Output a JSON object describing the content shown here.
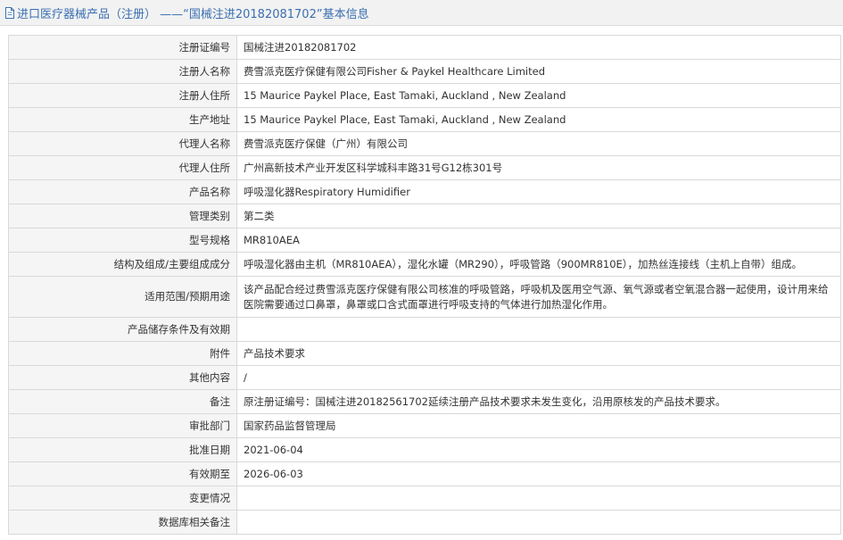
{
  "header": {
    "title": "进口医疗器械产品（注册） ——“国械注进20182081702”基本信息",
    "icon": "document-icon"
  },
  "rows": [
    {
      "label": "注册证编号",
      "value": "国械注进20182081702"
    },
    {
      "label": "注册人名称",
      "value": "费雪派克医疗保健有限公司Fisher & Paykel Healthcare Limited"
    },
    {
      "label": "注册人住所",
      "value": "15 Maurice Paykel Place, East Tamaki, Auckland , New Zealand"
    },
    {
      "label": "生产地址",
      "value": "15 Maurice Paykel Place, East Tamaki, Auckland , New Zealand"
    },
    {
      "label": "代理人名称",
      "value": "费雪派克医疗保健（广州）有限公司"
    },
    {
      "label": "代理人住所",
      "value": "广州高新技术产业开发区科学城科丰路31号G12栋301号"
    },
    {
      "label": "产品名称",
      "value": "呼吸湿化器Respiratory Humidifier"
    },
    {
      "label": "管理类别",
      "value": "第二类"
    },
    {
      "label": "型号规格",
      "value": "MR810AEA"
    },
    {
      "label": "结构及组成/主要组成成分",
      "value": "呼吸湿化器由主机（MR810AEA），湿化水罐（MR290），呼吸管路（900MR810E），加热丝连接线（主机上自带）组成。"
    },
    {
      "label": "适用范围/预期用途",
      "value": "该产品配合经过费雪派克医疗保健有限公司核准的呼吸管路，呼吸机及医用空气源、氧气源或者空氧混合器一起使用，设计用来给医院需要通过口鼻罩，鼻罩或口含式面罩进行呼吸支持的气体进行加热湿化作用。"
    },
    {
      "label": "产品储存条件及有效期",
      "value": ""
    },
    {
      "label": "附件",
      "value": "产品技术要求"
    },
    {
      "label": "其他内容",
      "value": "/"
    },
    {
      "label": "备注",
      "value": "原注册证编号：国械注进20182561702延续注册产品技术要求未发生变化，沿用原核发的产品技术要求。"
    },
    {
      "label": "审批部门",
      "value": "国家药品监督管理局"
    },
    {
      "label": "批准日期",
      "value": "2021-06-04"
    },
    {
      "label": "有效期至",
      "value": "2026-06-03"
    },
    {
      "label": "变更情况",
      "value": ""
    },
    {
      "label": "数据库相关备注",
      "value": ""
    }
  ]
}
